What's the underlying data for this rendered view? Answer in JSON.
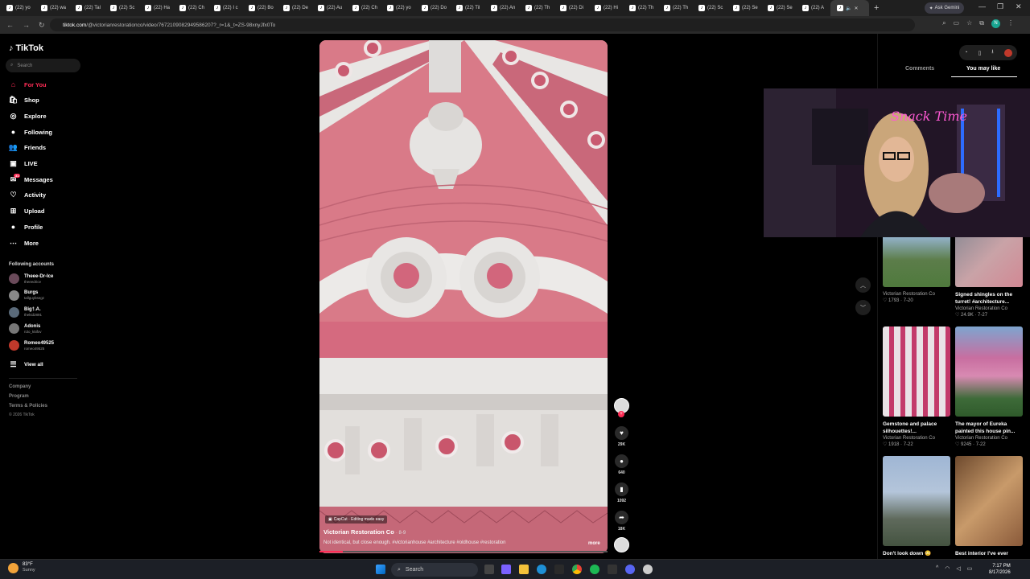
{
  "browser": {
    "tabs": [
      "(22) yo",
      "(22) wa",
      "(22) Tal",
      "(22) Sc",
      "(22) Ha",
      "(22) Ch",
      "(22) I c",
      "(22) Bo",
      "(22) De",
      "(22) Au",
      "(22) Ch",
      "(22) yo",
      "(22) Do",
      "(22) Til",
      "(22) An",
      "(22) Th",
      "(22) Di",
      "(22) Hi",
      "(22) Th",
      "(22) Th",
      "(22) Sc",
      "(22) Se",
      "(22) Se",
      "(22) A"
    ],
    "new_tab": "+",
    "ask_gemini": "Ask Gemini",
    "url_domain": "tiktok.com",
    "url_path": "/@victorianrestorationco/video/7672109082949586207?_r=1&_t=ZS-98xnyJfx0To"
  },
  "sidebar": {
    "logo": "TikTok",
    "search_placeholder": "Search",
    "nav": [
      {
        "label": "For You",
        "icon": "home-icon"
      },
      {
        "label": "Shop",
        "icon": "shop-icon"
      },
      {
        "label": "Explore",
        "icon": "compass-icon"
      },
      {
        "label": "Following",
        "icon": "following-icon"
      },
      {
        "label": "Friends",
        "icon": "friends-icon"
      },
      {
        "label": "LIVE",
        "icon": "live-icon"
      },
      {
        "label": "Messages",
        "icon": "messages-icon",
        "badge": "31"
      },
      {
        "label": "Activity",
        "icon": "activity-icon"
      },
      {
        "label": "Upload",
        "icon": "upload-icon"
      },
      {
        "label": "Profile",
        "icon": "profile-icon"
      },
      {
        "label": "More",
        "icon": "more-icon"
      }
    ],
    "following_title": "Following accounts",
    "accounts": [
      {
        "name": "Theee-Dr-Ice",
        "handle": "theeedrice",
        "color": "#6a4a5a"
      },
      {
        "name": "Burgs",
        "handle": "tallguybsegz",
        "color": "#888888"
      },
      {
        "name": "Big†.A.",
        "handle": "thekid2891",
        "color": "#5a6a7a"
      },
      {
        "name": "Adonis",
        "handle": "n3o_k5ifxv",
        "color": "#777777"
      },
      {
        "name": "Romeo49525",
        "handle": "romeo49525",
        "color": "#c0392b"
      }
    ],
    "view_all": "View all",
    "footer": [
      "Company",
      "Program",
      "Terms & Policies",
      "© 2026 TikTok"
    ]
  },
  "video": {
    "capcut": "CapCut · Editing made easy",
    "author": "Victorian Restoration Co",
    "date": "· 8-9",
    "description": "Not identical, but close enough. #victorianhouse #architecture #oldhouse #restoration",
    "more": "more",
    "progress": 0.08
  },
  "actions": {
    "likes": "29K",
    "comments": "640",
    "saves": "1092",
    "shares": "18K"
  },
  "right_panel": {
    "tab_comments": "Comments",
    "tab_you_may_like": "You may like",
    "cards": [
      {
        "title": "",
        "author": "Victorian Restoration Co",
        "meta": "♡ 1793 · 7-20"
      },
      {
        "title": "Signed shingles on the turret! #architecture...",
        "author": "Victorian Restoration Co",
        "meta": "♡ 24.9K · 7-27"
      },
      {
        "title": "Gemstone and palace silhouettes!...",
        "author": "Victorian Restoration Co",
        "meta": "♡ 1918 · 7-22"
      },
      {
        "title": "The mayor of Eureka painted this house pin...",
        "author": "Victorian Restoration Co",
        "meta": "♡ 9245 · 7-22"
      },
      {
        "title": "Don't look down 😳",
        "author": "",
        "meta": ""
      },
      {
        "title": "Best interior I've ever",
        "author": "",
        "meta": ""
      }
    ]
  },
  "webcam": {
    "sign_text": "Snack Time"
  },
  "taskbar": {
    "temp": "83°F",
    "condition": "Sunny",
    "search": "Search",
    "time": "7:17 PM",
    "date": "8/17/2026"
  }
}
